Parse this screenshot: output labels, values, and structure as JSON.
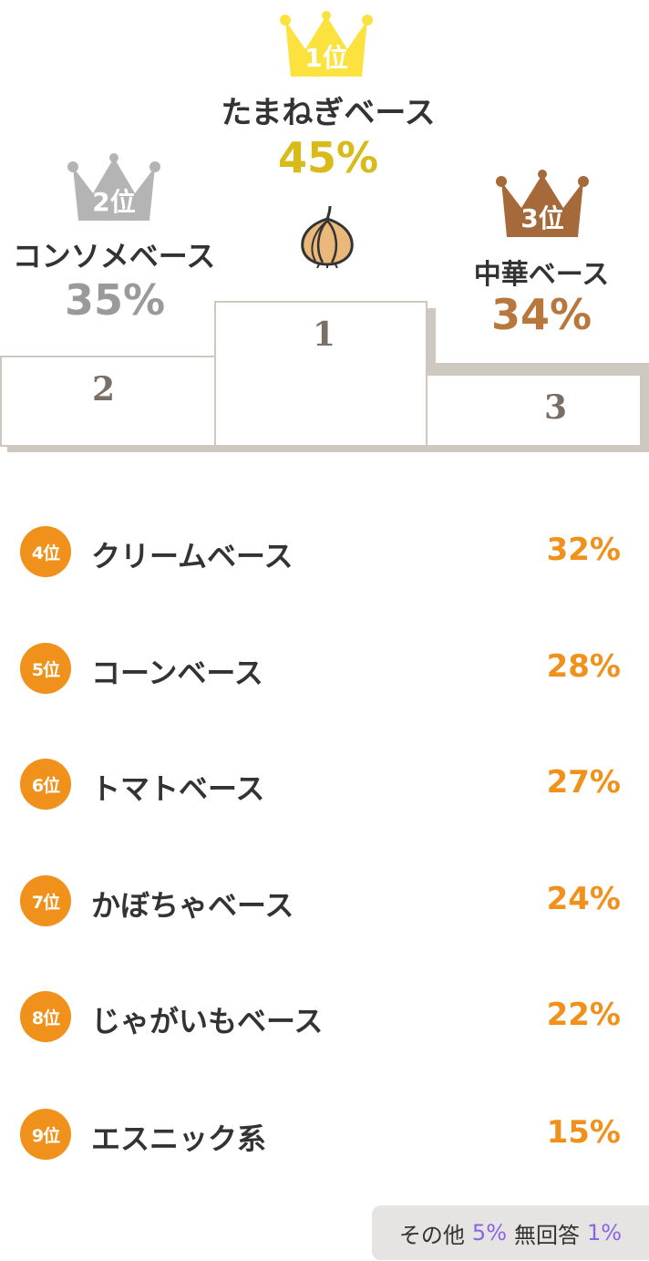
{
  "podium": {
    "first": {
      "rank_label": "1位",
      "name": "たまねぎベース",
      "percent": "45%",
      "crown_color": "#fce23f",
      "pct_color": "#d8bb1b",
      "step_number": "1",
      "icon": "onion-icon"
    },
    "second": {
      "rank_label": "2位",
      "name": "コンソメベース",
      "percent": "35%",
      "crown_color": "#b4b4b4",
      "pct_color": "#9a9a9a",
      "step_number": "2"
    },
    "third": {
      "rank_label": "3位",
      "name": "中華ベース",
      "percent": "34%",
      "crown_color": "#a66a3a",
      "pct_color": "#b8773d",
      "step_number": "3"
    }
  },
  "ranking": [
    {
      "rank": "4位",
      "name": "クリームベース",
      "percent": "32%"
    },
    {
      "rank": "5位",
      "name": "コーンベース",
      "percent": "28%"
    },
    {
      "rank": "6位",
      "name": "トマトベース",
      "percent": "27%"
    },
    {
      "rank": "7位",
      "name": "かぼちゃベース",
      "percent": "24%"
    },
    {
      "rank": "8位",
      "name": "じゃがいもベース",
      "percent": "22%"
    },
    {
      "rank": "9位",
      "name": "エスニック系",
      "percent": "15%"
    }
  ],
  "others": {
    "other_label": "その他",
    "other_value": "5%",
    "no_answer_label": "無回答",
    "no_answer_value": "1%"
  },
  "colors": {
    "accent": "#f0911c",
    "podium_border": "#cfc8c0",
    "others_value": "#8b64e6"
  }
}
